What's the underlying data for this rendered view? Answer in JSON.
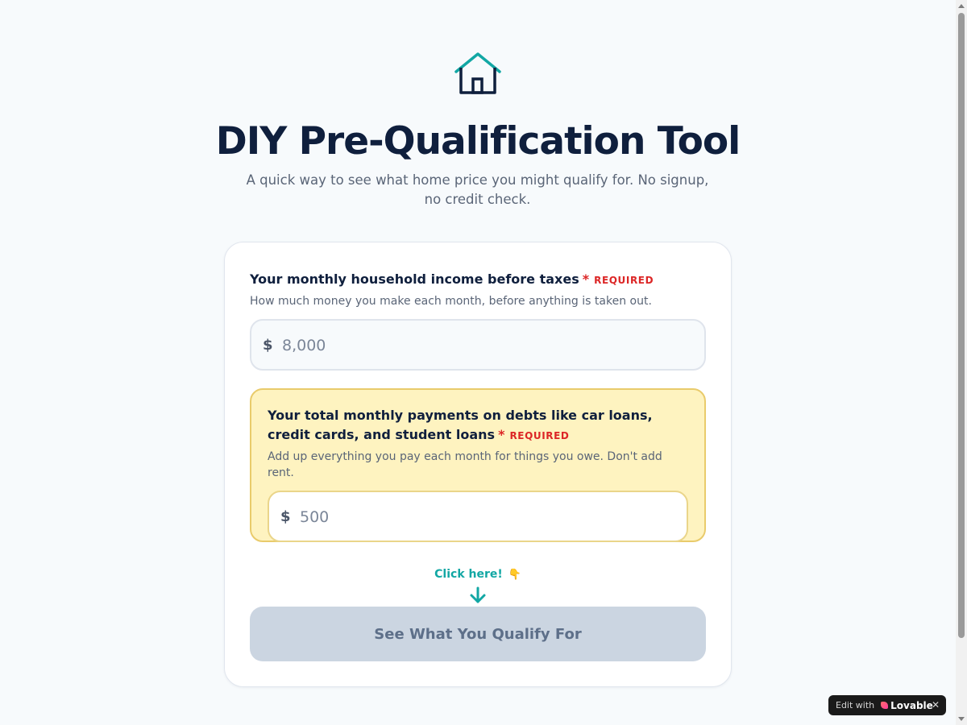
{
  "header": {
    "logo_icon": "house-icon",
    "title": "DIY Pre-Qualification Tool",
    "subtitle": "A quick way to see what home price you might qualify for. No signup, no credit check."
  },
  "form": {
    "income": {
      "label": "Your monthly household income before taxes",
      "required_star": "*",
      "required_tag": "REQUIRED",
      "hint": "How much money you make each month, before anything is taken out.",
      "currency": "$",
      "placeholder": "8,000",
      "value": ""
    },
    "debts": {
      "label": "Your total monthly payments on debts like car loans, credit cards, and student loans",
      "required_star": "*",
      "required_tag": "REQUIRED",
      "hint": "Add up everything you pay each month for things you owe. Don't add rent.",
      "currency": "$",
      "placeholder": "500",
      "value": ""
    },
    "click_hint": "Click here!",
    "click_hint_emoji": "👇",
    "submit_label": "See What You Qualify For"
  },
  "badge": {
    "prefix": "Edit with",
    "brand": "Lovable",
    "close_glyph": "✕"
  },
  "colors": {
    "navy": "#0f1f3d",
    "teal": "#12a7a4",
    "required_red": "#dc2626",
    "highlight_bg": "#fef3c0",
    "highlight_border": "#e9cb6b",
    "button_disabled": "#cbd5e1"
  }
}
